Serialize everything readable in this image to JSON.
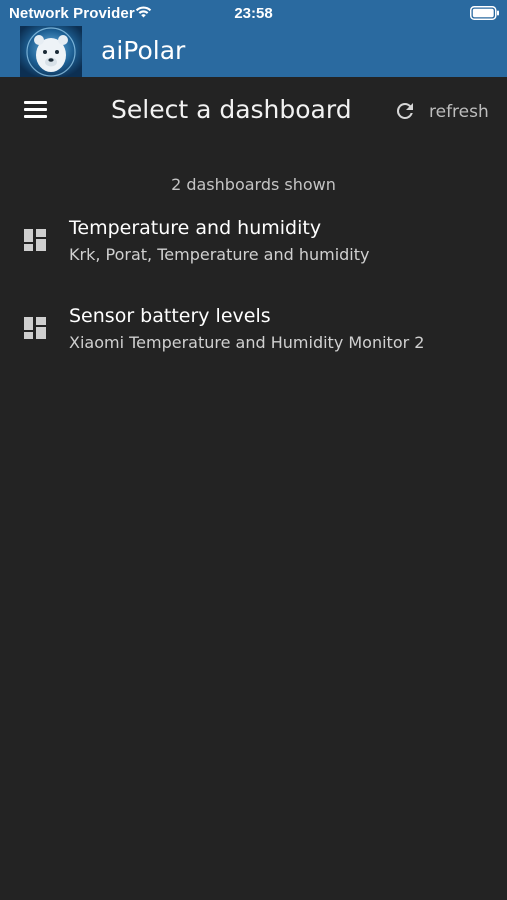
{
  "status_bar": {
    "carrier": "Network Provider",
    "time": "23:58",
    "wifi_icon": "wifi-icon",
    "battery_icon": "battery-icon"
  },
  "app": {
    "name": "aiPolar",
    "logo": "polar-bear-logo",
    "brand_color": "#2a6aa0"
  },
  "toolbar": {
    "menu_icon": "hamburger-menu-icon",
    "title": "Select a dashboard",
    "refresh_icon": "refresh-icon",
    "refresh_label": "refresh"
  },
  "content": {
    "count_text": "2 dashboards shown",
    "dashboards": [
      {
        "icon": "dashboard-icon",
        "title": "Temperature and humidity",
        "subtitle": "Krk, Porat, Temperature and humidity"
      },
      {
        "icon": "dashboard-icon",
        "title": "Sensor battery levels",
        "subtitle": "Xiaomi Temperature and Humidity Monitor 2"
      }
    ]
  },
  "colors": {
    "background": "#232323",
    "header": "#2a6aa0"
  }
}
